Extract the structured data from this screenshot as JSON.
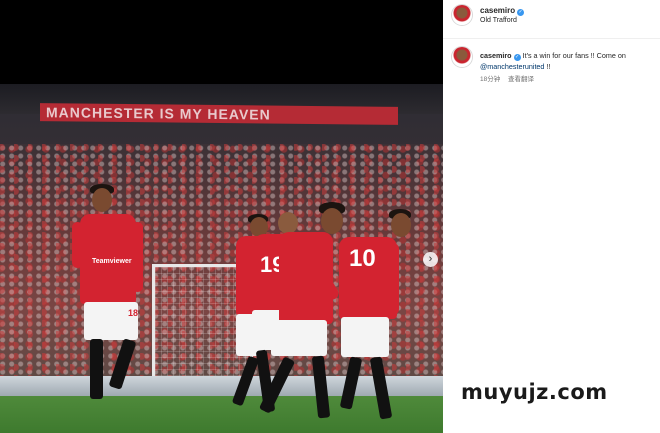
{
  "post": {
    "author": "casemiro",
    "location": "Old Trafford",
    "caption_author": "casemiro",
    "caption_text": "It's a win for our fans !! Come on",
    "caption_mention": "@manchesterunited",
    "caption_suffix": "!!",
    "time_ago": "18分钟",
    "translate_label": "查看翻译",
    "verified_icon": "✓"
  },
  "photo": {
    "stadium_banner": "MANCHESTER IS MY HEAVEN",
    "shirt_numbers": [
      "18",
      "19",
      "10"
    ],
    "sponsor": "Teamviewer",
    "next_icon": "›"
  },
  "watermark": "muyujz.com",
  "colors": {
    "united_red": "#d32330",
    "verified_blue": "#3897f0",
    "mention_blue": "#00376b"
  }
}
